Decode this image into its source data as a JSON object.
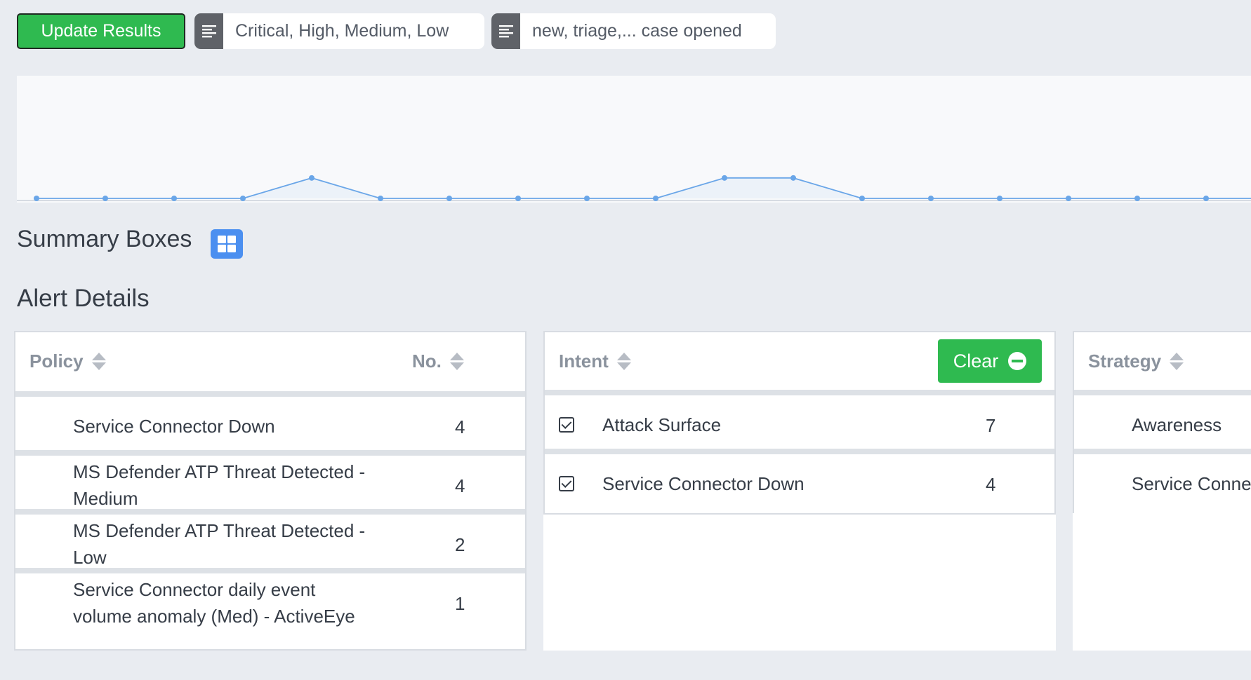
{
  "toolbar": {
    "update_label": "Update Results",
    "severity_filter": "Critical, High, Medium, Low",
    "status_filter": "new, triage,... case opened",
    "filter_icon": "list-icon"
  },
  "colors": {
    "primary_green": "#2fba50",
    "accent_blue": "#4b8ff0",
    "line_blue": "#6aa6e8"
  },
  "chart_data": {
    "type": "line",
    "values": [
      0,
      0,
      0,
      0,
      1,
      0,
      0,
      0,
      0,
      0,
      1,
      1,
      0,
      0,
      0,
      0,
      0,
      0,
      0
    ],
    "ylim": [
      0,
      6
    ],
    "grid": false
  },
  "summary": {
    "title": "Summary Boxes",
    "icon": "grid-icon"
  },
  "alerts": {
    "title": "Alert Details",
    "policy": {
      "col_name": "Policy",
      "col_count": "No.",
      "rows": [
        {
          "name_line1": "Service Connector Down",
          "name_line2": "",
          "count": "4"
        },
        {
          "name_line1": "MS Defender ATP Threat Detected -",
          "name_line2": "Medium",
          "count": "4"
        },
        {
          "name_line1": "MS Defender ATP Threat Detected -",
          "name_line2": "Low",
          "count": "2"
        },
        {
          "name_line1": "Service Connector daily event",
          "name_line2": "volume anomaly (Med) - ActiveEye",
          "count": "1"
        }
      ]
    },
    "intent": {
      "col_name": "Intent",
      "clear_label": "Clear",
      "rows": [
        {
          "name": "Attack Surface",
          "count": "7",
          "checked": true
        },
        {
          "name": "Service Connector Down",
          "count": "4",
          "checked": true
        }
      ]
    },
    "strategy": {
      "col_name": "Strategy",
      "rows": [
        {
          "name": "Awareness"
        },
        {
          "name": "Service Conne"
        }
      ]
    }
  }
}
